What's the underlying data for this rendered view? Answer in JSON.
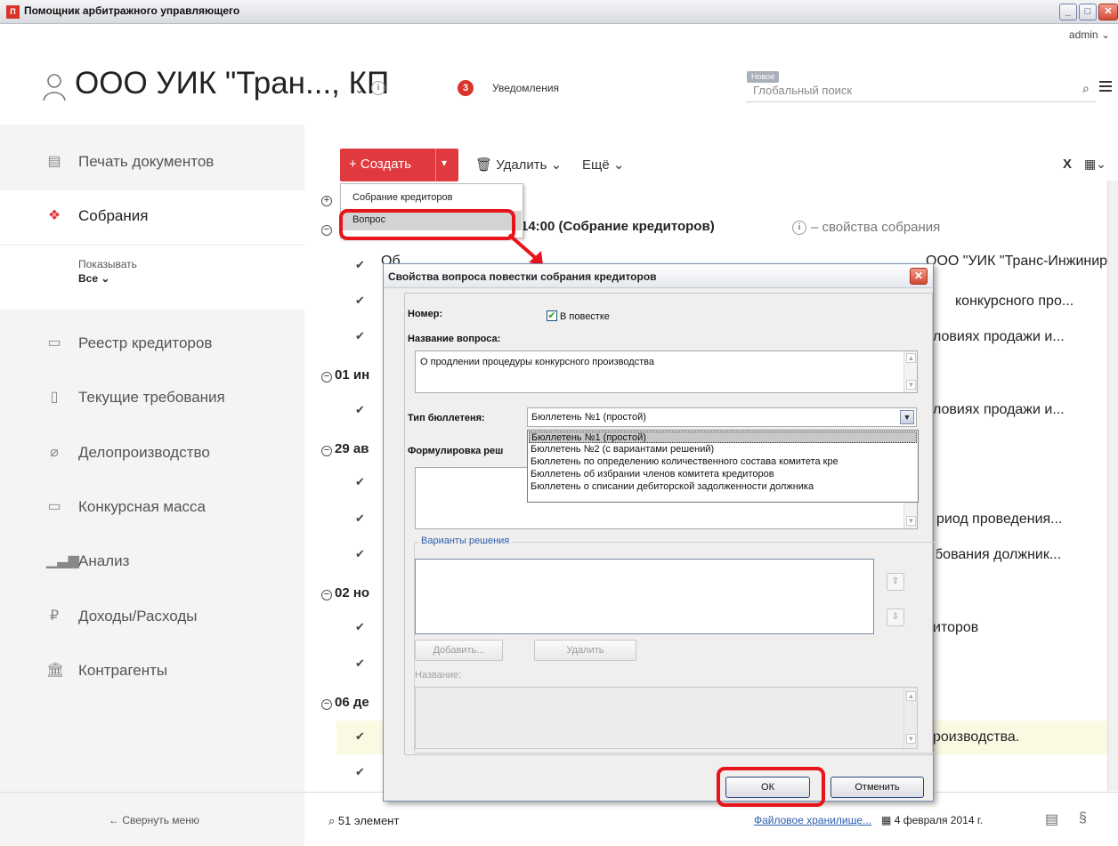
{
  "window": {
    "icon": "П",
    "title": "Помощник арбитражного управляющего"
  },
  "header": {
    "user": "admin",
    "org_name": "ООО УИК \"Тран..., КП",
    "notif_count": "3",
    "notif_label": "Уведомления",
    "new_tag": "Новое",
    "search_placeholder": "Глобальный поиск"
  },
  "sidebar": {
    "items": [
      {
        "label": "Печать документов",
        "icon": "print-icon"
      },
      {
        "label": "Собрания",
        "icon": "handshake-icon"
      },
      {
        "label": "Реестр кредиторов",
        "icon": "registry-icon"
      },
      {
        "label": "Текущие требования",
        "icon": "document-icon"
      },
      {
        "label": "Делопроизводство",
        "icon": "paperclip-icon"
      },
      {
        "label": "Конкурсная масса",
        "icon": "box-icon"
      },
      {
        "label": "Анализ",
        "icon": "bar-chart-icon"
      },
      {
        "label": "Доходы/Расходы",
        "icon": "ruble-icon"
      },
      {
        "label": "Контрагенты",
        "icon": "bank-icon"
      }
    ],
    "show_label": "Показывать",
    "show_value": "Все",
    "collapse": "Свернуть меню"
  },
  "toolbar": {
    "create": "+ Создать",
    "delete": "Удалить",
    "more": "Ещё",
    "x": "X"
  },
  "create_menu": {
    "items": [
      "Собрание кредиторов",
      "Вопрос"
    ]
  },
  "list": {
    "group1": "14:00 (Собрание кредиторов)",
    "group1_props": "– свойства собрания",
    "rows_right": [
      "ООО \"УИК \"Транс-Инжинири...",
      "конкурсного про...",
      "ловиях продажи и...",
      "ловиях продажи и...",
      "риод проведения...",
      "бования должник...",
      "иторов",
      "роизводства."
    ],
    "groups": [
      "01 ин",
      "29 ав",
      "02 но",
      "06 де"
    ],
    "rows_left_partial": "Об"
  },
  "status": {
    "count": "51 элемент",
    "storage": "Файловое хранилище...",
    "date": "4 февраля 2014 г."
  },
  "dialog": {
    "title": "Свойства вопроса повестки собрания кредиторов",
    "number_label": "Номер:",
    "agenda_label": "В повестке",
    "name_label": "Название вопроса:",
    "name_value": "О продлении процедуры конкурсного производства",
    "ballot_label": "Тип бюллетеня:",
    "ballot_value": "Бюллетень №1 (простой)",
    "ballot_options": [
      "Бюллетень №1 (простой)",
      "Бюллетень №2 (с вариантами решений)",
      "Бюллетень по определению количественного состава комитета кре",
      "Бюллетень об избрании членов комитета кредиторов",
      "Бюллетень о списании дебиторской задолженности должника"
    ],
    "formulation_label": "Формулировка реш",
    "variants_legend": "Варианты решения",
    "add_btn": "Добавить...",
    "delete_btn": "Удалить",
    "name_field_label": "Название:",
    "ok": "ОК",
    "cancel": "Отменить"
  },
  "colors": {
    "accent": "#e03a3e",
    "highlight_box": "#e8141b",
    "row_highlight": "#fcf9e2"
  }
}
